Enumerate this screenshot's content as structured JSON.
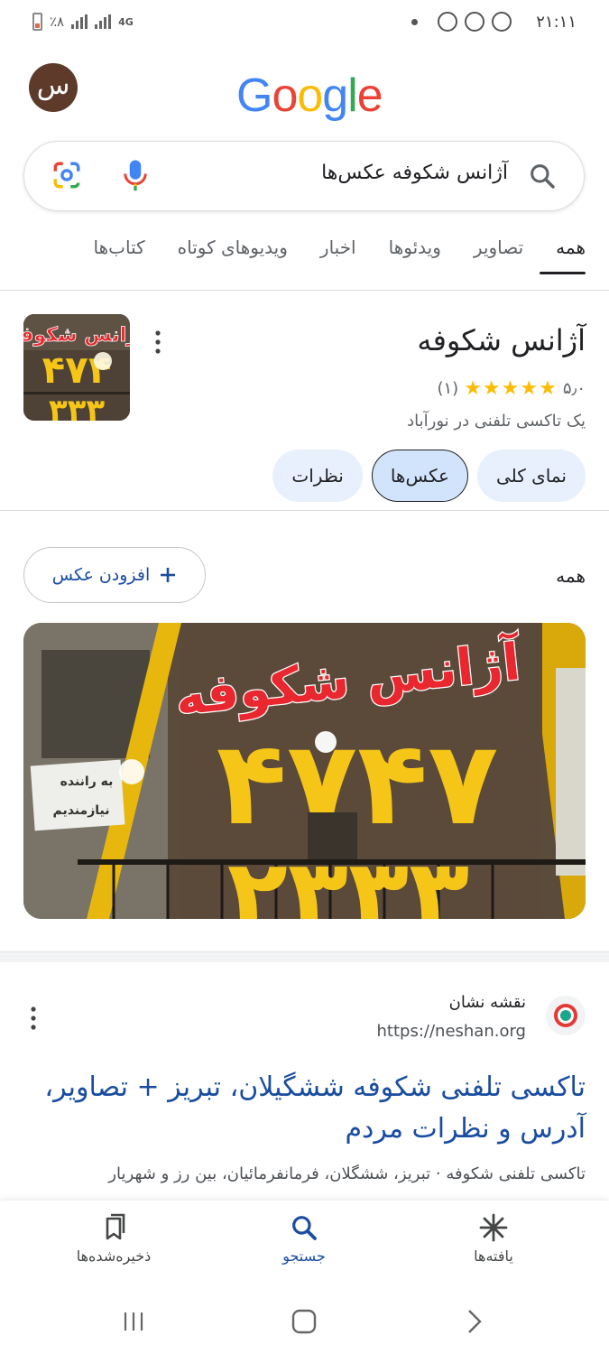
{
  "status_bar": {
    "time": "۲۱:۱۱",
    "battery": "٪۸",
    "network": "4G"
  },
  "header": {
    "avatar_letter": "س",
    "logo": [
      "G",
      "o",
      "o",
      "g",
      "l",
      "e"
    ],
    "logo_colors": [
      "#4285f4",
      "#ea4335",
      "#fbbc05",
      "#4285f4",
      "#34a853",
      "#ea4335"
    ]
  },
  "search": {
    "query": "آژانس شکوفه عکس‌ها"
  },
  "tabs": [
    "همه",
    "تصاویر",
    "ویدئوها",
    "اخبار",
    "ویدیوهای کوتاه",
    "کتاب‌ها"
  ],
  "knowledge_panel": {
    "title": "آژانس شکوفه",
    "rating": "۵٫۰",
    "stars": "★★★★★",
    "rating_value": 5,
    "review_count": "(۱)",
    "subtitle": "یک تاکسی تلفنی در نورآباد",
    "chips": [
      "نمای کلی",
      "عکس‌ها",
      "نظرات"
    ],
    "active_chip": 1
  },
  "photos": {
    "section_label": "همه",
    "add_photo_label": "افزودن عکس",
    "sign_text": "آژانس شکوفه",
    "sign_number": "۴۷۴۷",
    "sign_bottom": "۲۳۳۳",
    "poster_line1": "به راننده",
    "poster_line2": "نیازمندیم"
  },
  "result": {
    "site_name": "نقشه نشان",
    "url": "https://neshan.org",
    "title": "تاکسی تلفنی شکوفه ششگیلان، تبریز + تصاویر، آدرس و نظرات مردم",
    "snippet": "تاکسی تلفنی شکوفه · تبریز، ششگلان، فرمانفرمائیان، بین رز و شهریار"
  },
  "bottom_nav": {
    "items": [
      "یافته‌ها",
      "جستجو",
      "ذخیره‌شده‌ها"
    ],
    "active": 1
  },
  "colors": {
    "link_blue": "#1a4da0",
    "chip_bg": "#e8f0fe",
    "star_yellow": "#fbbc04",
    "sign_yellow": "#f5c518",
    "sign_red": "#e8282e"
  }
}
